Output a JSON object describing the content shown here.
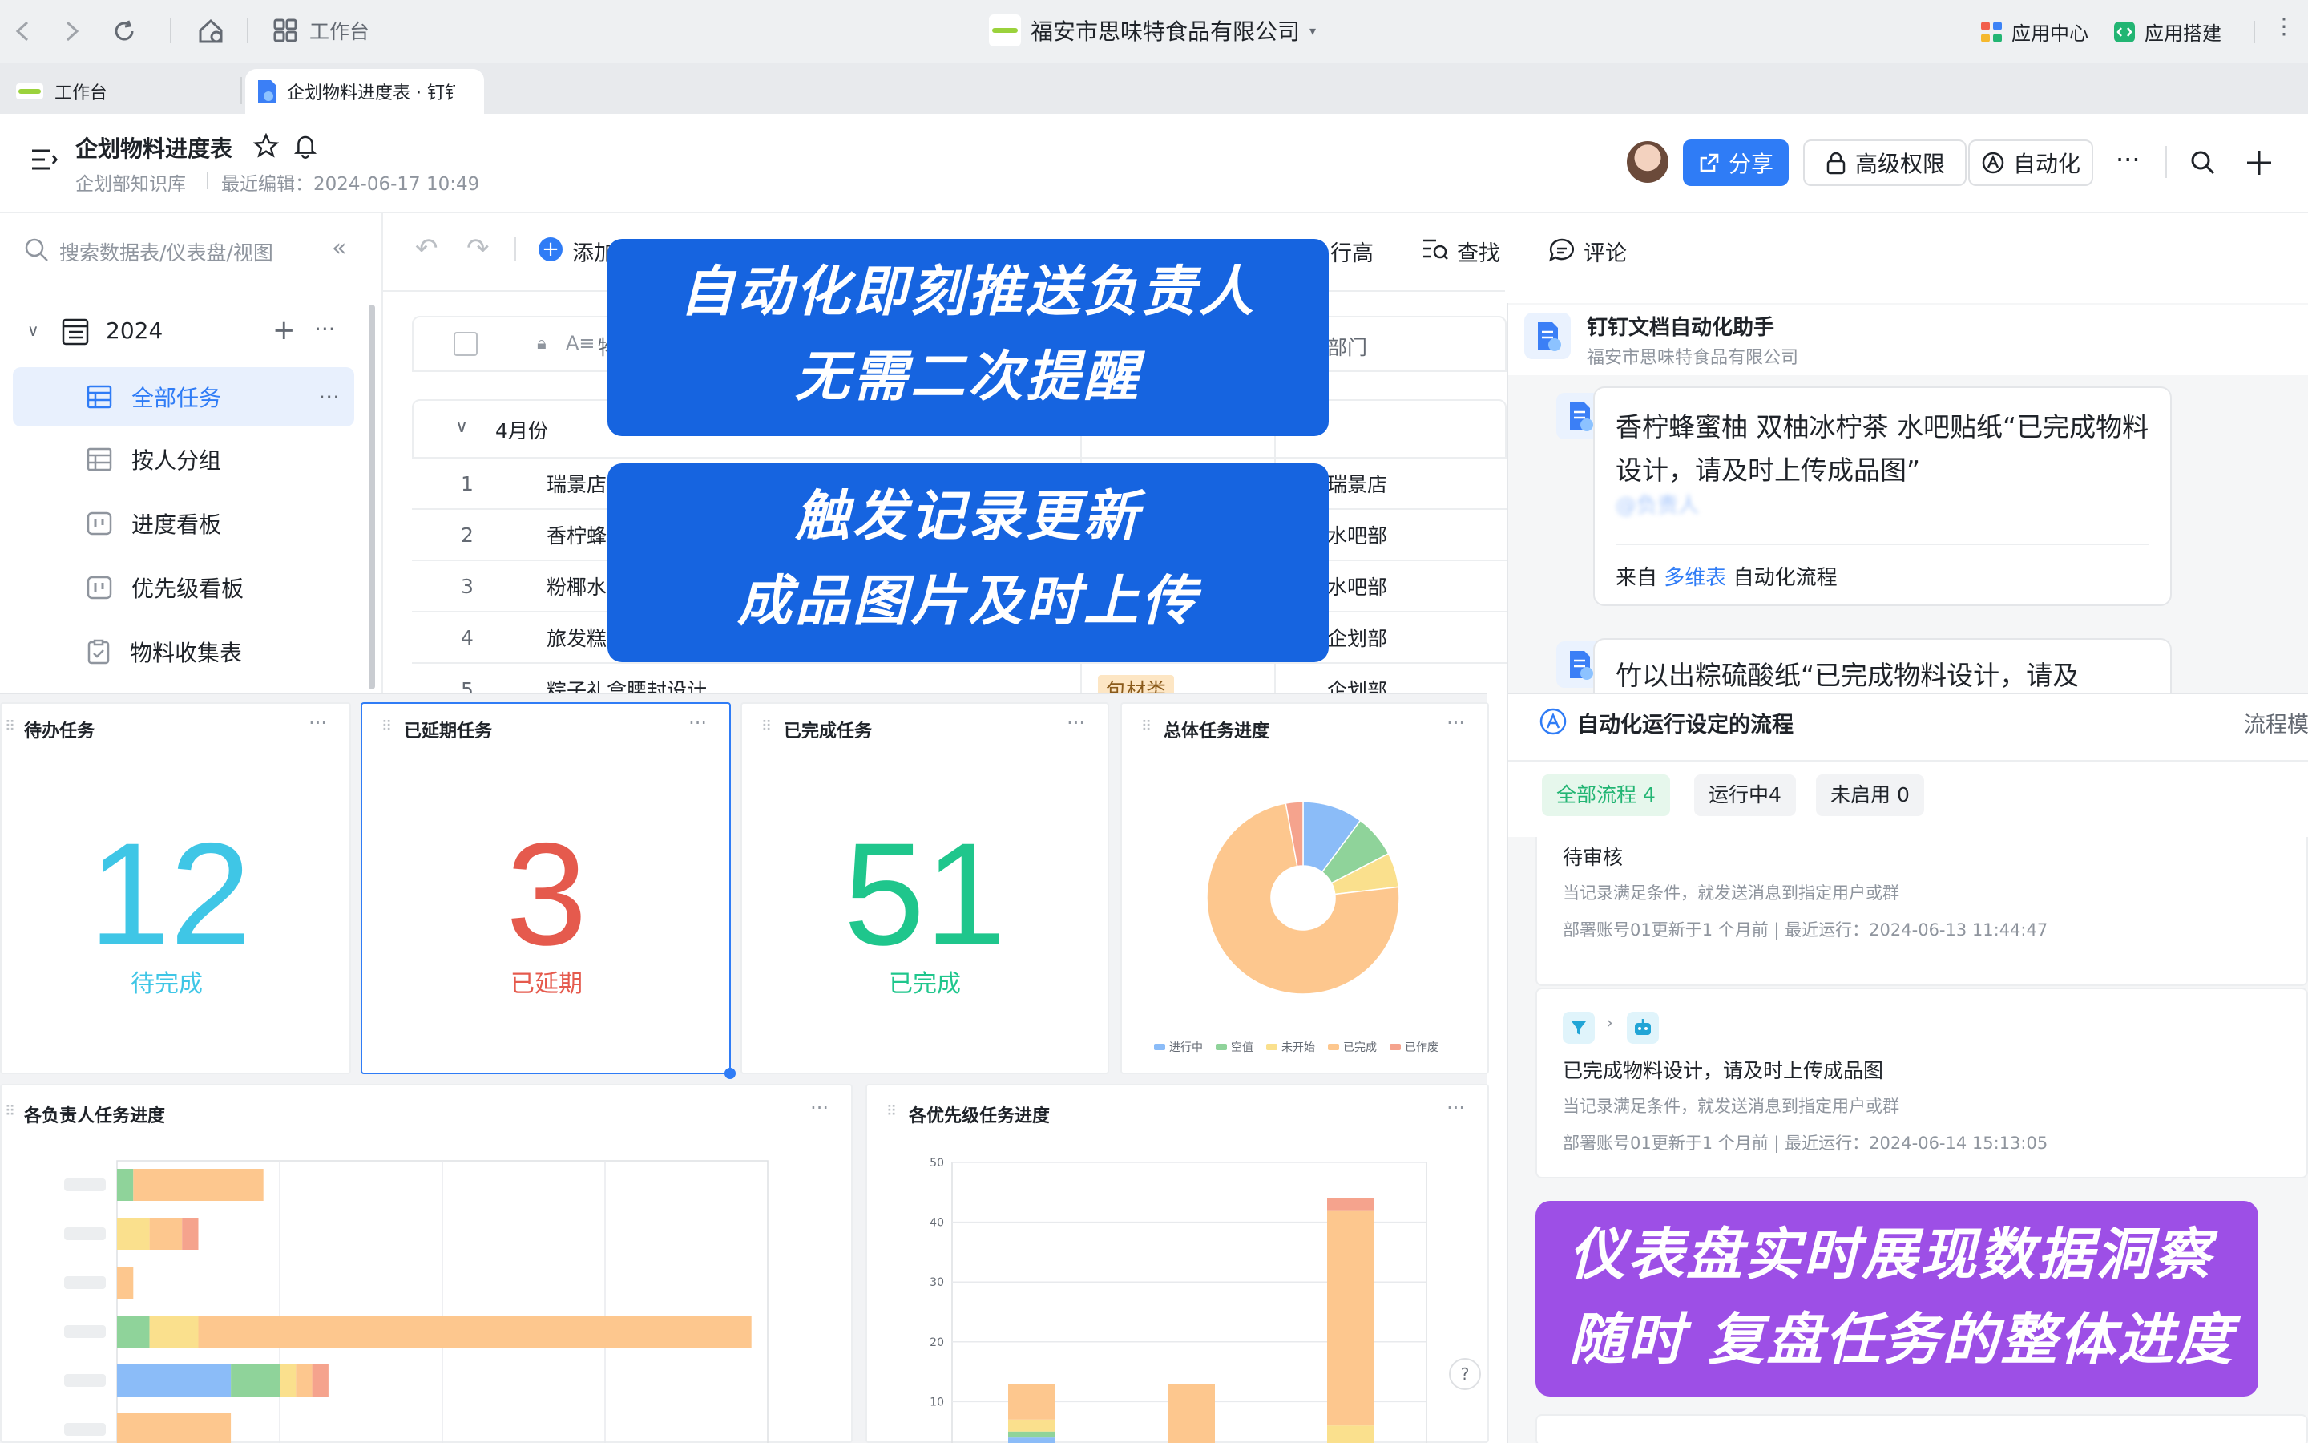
{
  "browser": {
    "workspace_label": "工作台",
    "company": "福安市思味特食品有限公司",
    "app_center": "应用中心",
    "app_builder": "应用搭建",
    "tabs": [
      {
        "label": "工作台"
      },
      {
        "label": "企划物料进度表 · 钉钉"
      }
    ]
  },
  "doc": {
    "title": "企划物料进度表",
    "kb": "企划部知识库",
    "last_edit": "最近编辑：2024-06-17 10:49",
    "share": "分享",
    "permission": "高级权限",
    "automation": "自动化"
  },
  "sidebar": {
    "search_placeholder": "搜索数据表/仪表盘/视图",
    "folder": "2024",
    "items": [
      {
        "label": "全部任务"
      },
      {
        "label": "按人分组"
      },
      {
        "label": "进度看板"
      },
      {
        "label": "优先级看板"
      },
      {
        "label": "物料收集表"
      }
    ]
  },
  "toolbar": {
    "add": "添加",
    "row_height": "行高",
    "find": "查找",
    "comment": "评论"
  },
  "table": {
    "header_partial": "物",
    "dept_header": "部门",
    "group": "4月份",
    "rows": [
      {
        "no": "1",
        "name": "瑞景店炸",
        "dept": "瑞景店"
      },
      {
        "no": "2",
        "name": "香柠蜂蜜",
        "dept": "水吧部"
      },
      {
        "no": "3",
        "name": "粉椰水",
        "dept": "水吧部"
      },
      {
        "no": "4",
        "name": "旅发糕点",
        "dept": "企划部"
      },
      {
        "no": "5",
        "name": "粽子礼盒腰封设计",
        "tag": "包材类",
        "dept": "企划部"
      }
    ]
  },
  "banners": {
    "b1_line1": "自动化即刻推送负责人",
    "b1_line2": "无需二次提醒",
    "b2_line1": "触发记录更新",
    "b2_line2": "成品图片及时上传",
    "b3_line1": "仪表盘实时展现数据洞察",
    "b3_line2": "随时 复盘任务的整体进度"
  },
  "assistant": {
    "name": "钉钉文档自动化助手",
    "company": "福安市思味特食品有限公司",
    "msg1": "香柠蜂蜜柚 双柚冰柠茶 水吧贴纸“已完成物料设计，请及时上传成品图”",
    "msg1_mention": "@负责人",
    "from_prefix": "来自",
    "from_link": "多维表",
    "from_suffix": "自动化流程",
    "msg2": "竹以出粽硫酸纸“已完成物料设计，请及"
  },
  "flows": {
    "title": "自动化运行设定的流程",
    "right_label": "流程模",
    "tabs": [
      {
        "label": "全部流程 4"
      },
      {
        "label": "运行中4"
      },
      {
        "label": "未启用 0"
      }
    ],
    "items": [
      {
        "name": "待审核",
        "desc": "当记录满足条件，就发送消息到指定用户或群",
        "meta": "部署账号01更新于1 个月前 | 最近运行：2024-06-13 11:44:47"
      },
      {
        "name": "已完成物料设计，请及时上传成品图",
        "desc": "当记录满足条件，就发送消息到指定用户或群",
        "meta": "部署账号01更新于1 个月前 | 最近运行：2024-06-14 15:13:05"
      }
    ]
  },
  "stats": {
    "pending": {
      "title": "待办任务",
      "value": "12",
      "label": "待完成",
      "color": "#3fc6e6"
    },
    "overdue": {
      "title": "已延期任务",
      "value": "3",
      "label": "已延期",
      "color": "#e55a4d"
    },
    "done": {
      "title": "已完成任务",
      "value": "51",
      "label": "已完成",
      "color": "#1fc68c"
    },
    "overall_title": "总体任务进度"
  },
  "donut": {
    "legend": [
      {
        "name": "进行中",
        "color": "#8bbcf8"
      },
      {
        "name": "空值",
        "color": "#8fd39a"
      },
      {
        "name": "未开始",
        "color": "#fae08d"
      },
      {
        "name": "已完成",
        "color": "#fdc78e"
      },
      {
        "name": "已作废",
        "color": "#f5a38d"
      }
    ],
    "slices": [
      {
        "name": "进行中",
        "value": 7
      },
      {
        "name": "空值",
        "value": 5
      },
      {
        "name": "未开始",
        "value": 4
      },
      {
        "name": "已完成",
        "value": 51
      },
      {
        "name": "已作废",
        "value": 2
      }
    ]
  },
  "chart_data": [
    {
      "type": "bar",
      "title": "各负责人任务进度",
      "orientation": "horizontal",
      "stacked": true,
      "categories": [
        "",
        "",
        "",
        "",
        "",
        ""
      ],
      "series": [
        {
          "color": "#8bbcf8",
          "values": [
            0,
            0,
            0,
            0,
            7,
            0
          ]
        },
        {
          "color": "#8fd39a",
          "values": [
            1,
            0,
            0,
            2,
            3,
            0
          ]
        },
        {
          "color": "#fae08d",
          "values": [
            0,
            2,
            0,
            3,
            1,
            0
          ]
        },
        {
          "color": "#fdc78e",
          "values": [
            8,
            2,
            1,
            34,
            1,
            7
          ]
        },
        {
          "color": "#f5a38d",
          "values": [
            0,
            1,
            0,
            0,
            1,
            0
          ]
        }
      ],
      "xlim": [
        0,
        40
      ]
    },
    {
      "type": "bar",
      "title": "各优先级任务进度",
      "stacked": true,
      "categories": [
        "",
        "",
        ""
      ],
      "series": [
        {
          "color": "#8bbcf8",
          "values": [
            4,
            0,
            0
          ]
        },
        {
          "color": "#8fd39a",
          "values": [
            1,
            1,
            1
          ]
        },
        {
          "color": "#fae08d",
          "values": [
            2,
            1,
            5
          ]
        },
        {
          "color": "#fdc78e",
          "values": [
            6,
            11,
            36
          ]
        },
        {
          "color": "#f5a38d",
          "values": [
            0,
            0,
            2
          ]
        }
      ],
      "ylim": [
        0,
        50
      ],
      "yticks": [
        50,
        40,
        30,
        20,
        10
      ]
    }
  ]
}
